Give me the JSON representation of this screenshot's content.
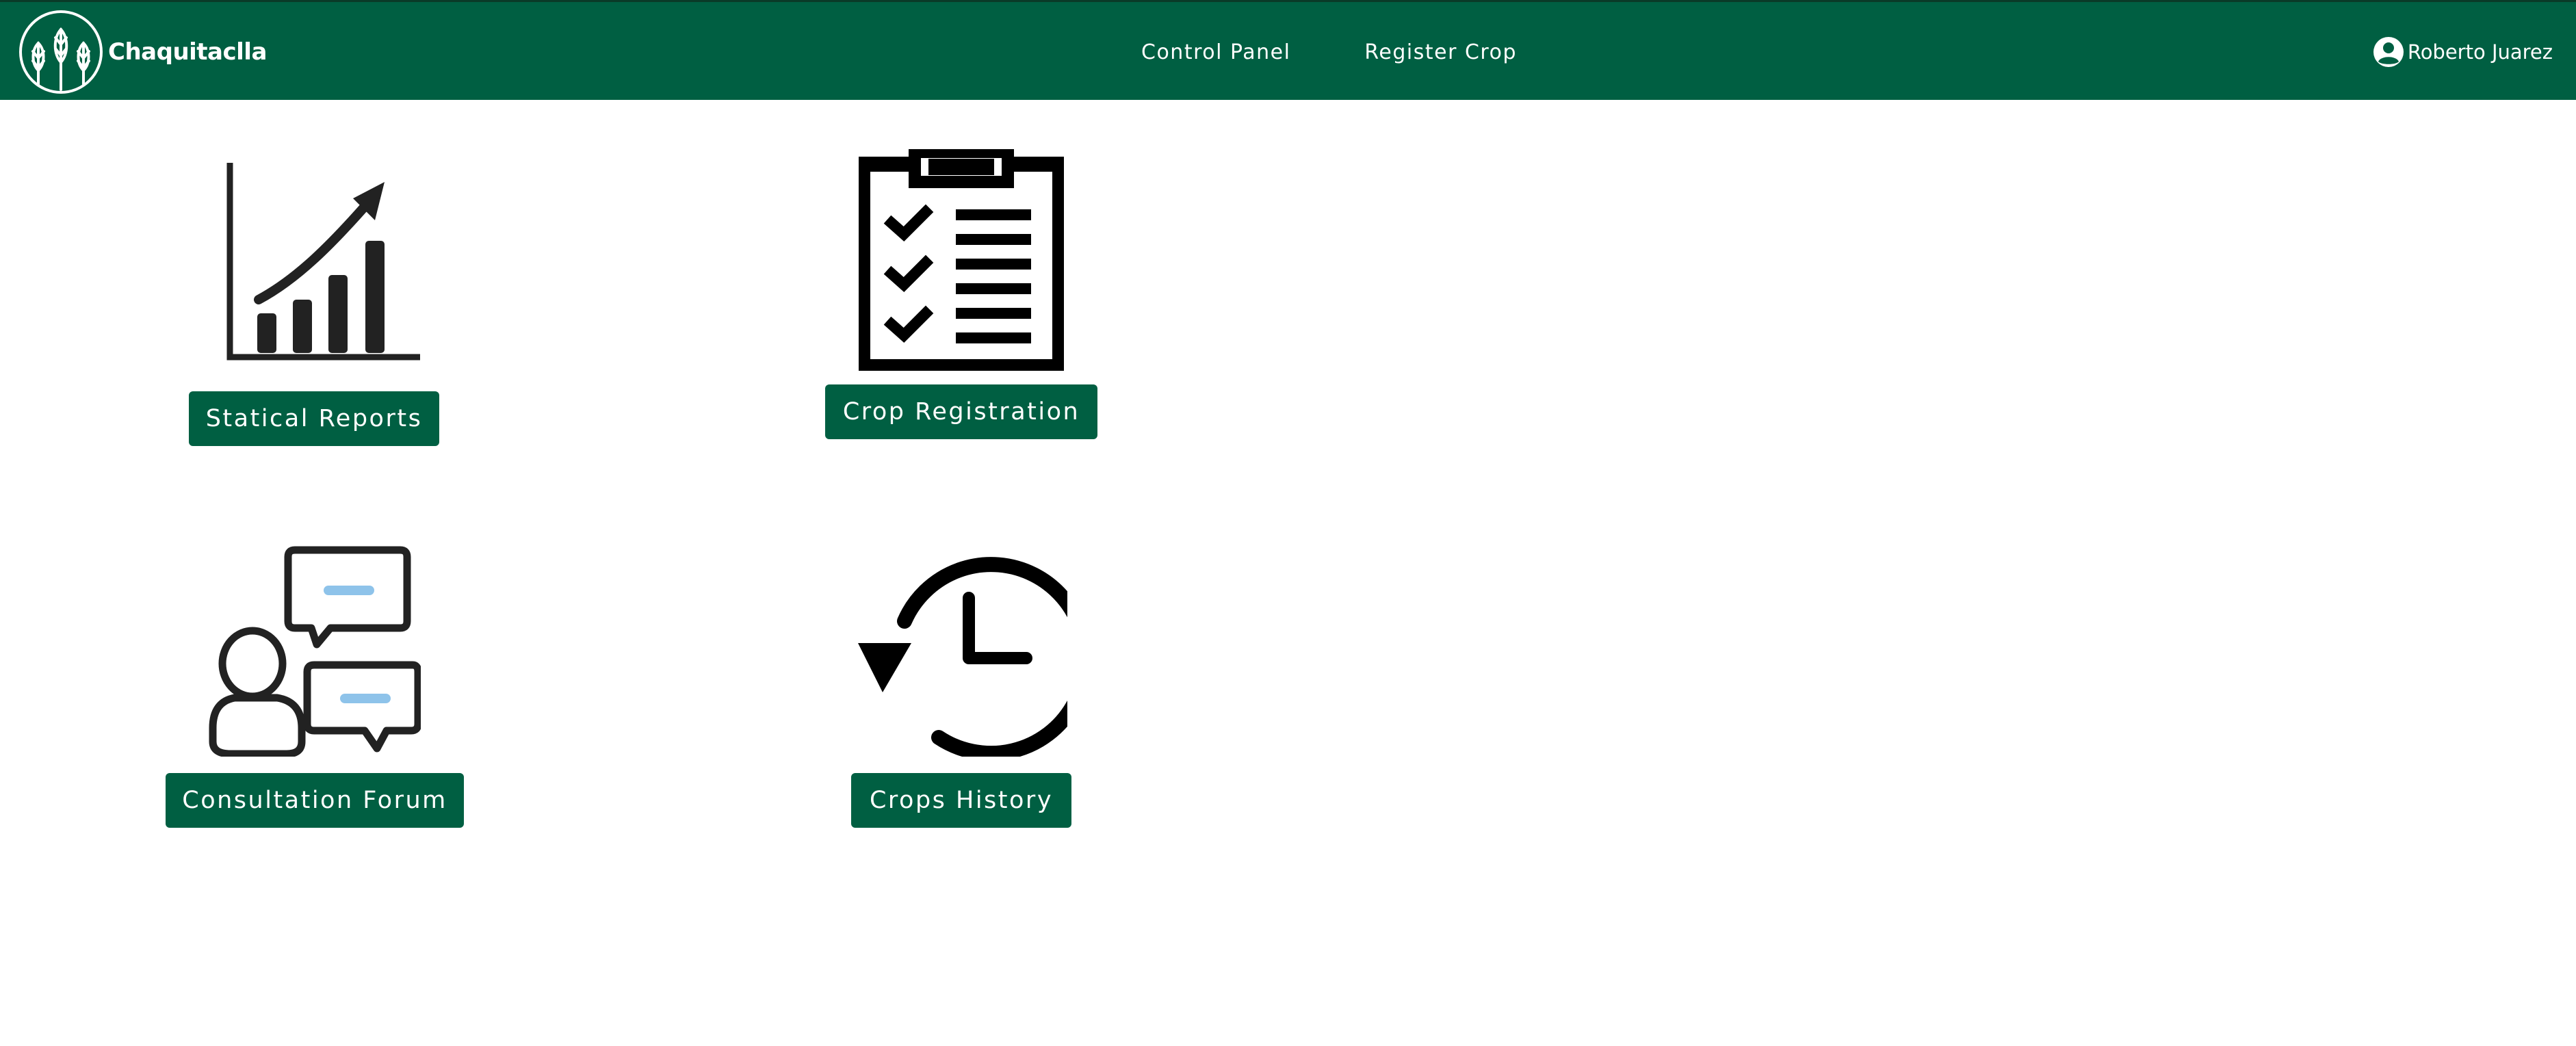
{
  "navbar": {
    "brand": {
      "name": "Chaquitaclla",
      "logo_icon": "wheat-logo-icon"
    },
    "links": [
      {
        "label": "Control Panel"
      },
      {
        "label": "Register Crop"
      }
    ],
    "user": {
      "name": "Roberto Juarez",
      "icon": "user-circle-icon"
    }
  },
  "tiles": {
    "reports": {
      "label": "Statical Reports",
      "icon": "bar-chart-growth-icon"
    },
    "register": {
      "label": "Crop Registration",
      "icon": "clipboard-checklist-icon"
    },
    "forum": {
      "label": "Consultation Forum",
      "icon": "chat-users-icon"
    },
    "history": {
      "label": "Crops History",
      "icon": "history-clock-icon"
    }
  },
  "colors": {
    "primary": "#005f42",
    "icon_dark": "#222222",
    "chat_accent": "#8ec3ea",
    "text_light": "#ffffff"
  }
}
